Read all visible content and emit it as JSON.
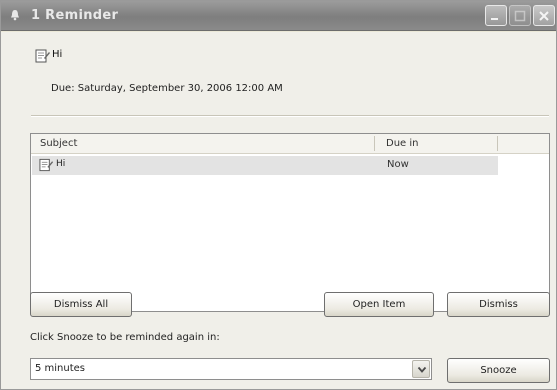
{
  "window": {
    "title": "1 Reminder",
    "icons": {
      "title": "bell-icon",
      "minimize": "minimize-icon",
      "maximize": "maximize-icon",
      "close": "close-icon"
    }
  },
  "summary": {
    "subject": "Hi",
    "due": "Due: Saturday, September 30, 2006 12:00 AM",
    "icon": "note-icon"
  },
  "list": {
    "columns": [
      "Subject",
      "Due in"
    ],
    "rows": [
      {
        "subject": "Hi",
        "due_in": "Now",
        "icon": "note-icon"
      }
    ]
  },
  "buttons": {
    "dismiss_all": "Dismiss All",
    "open_item": "Open Item",
    "dismiss": "Dismiss",
    "snooze": "Snooze"
  },
  "snooze": {
    "label": "Click Snooze to be reminded again in:",
    "selected": "5 minutes"
  }
}
